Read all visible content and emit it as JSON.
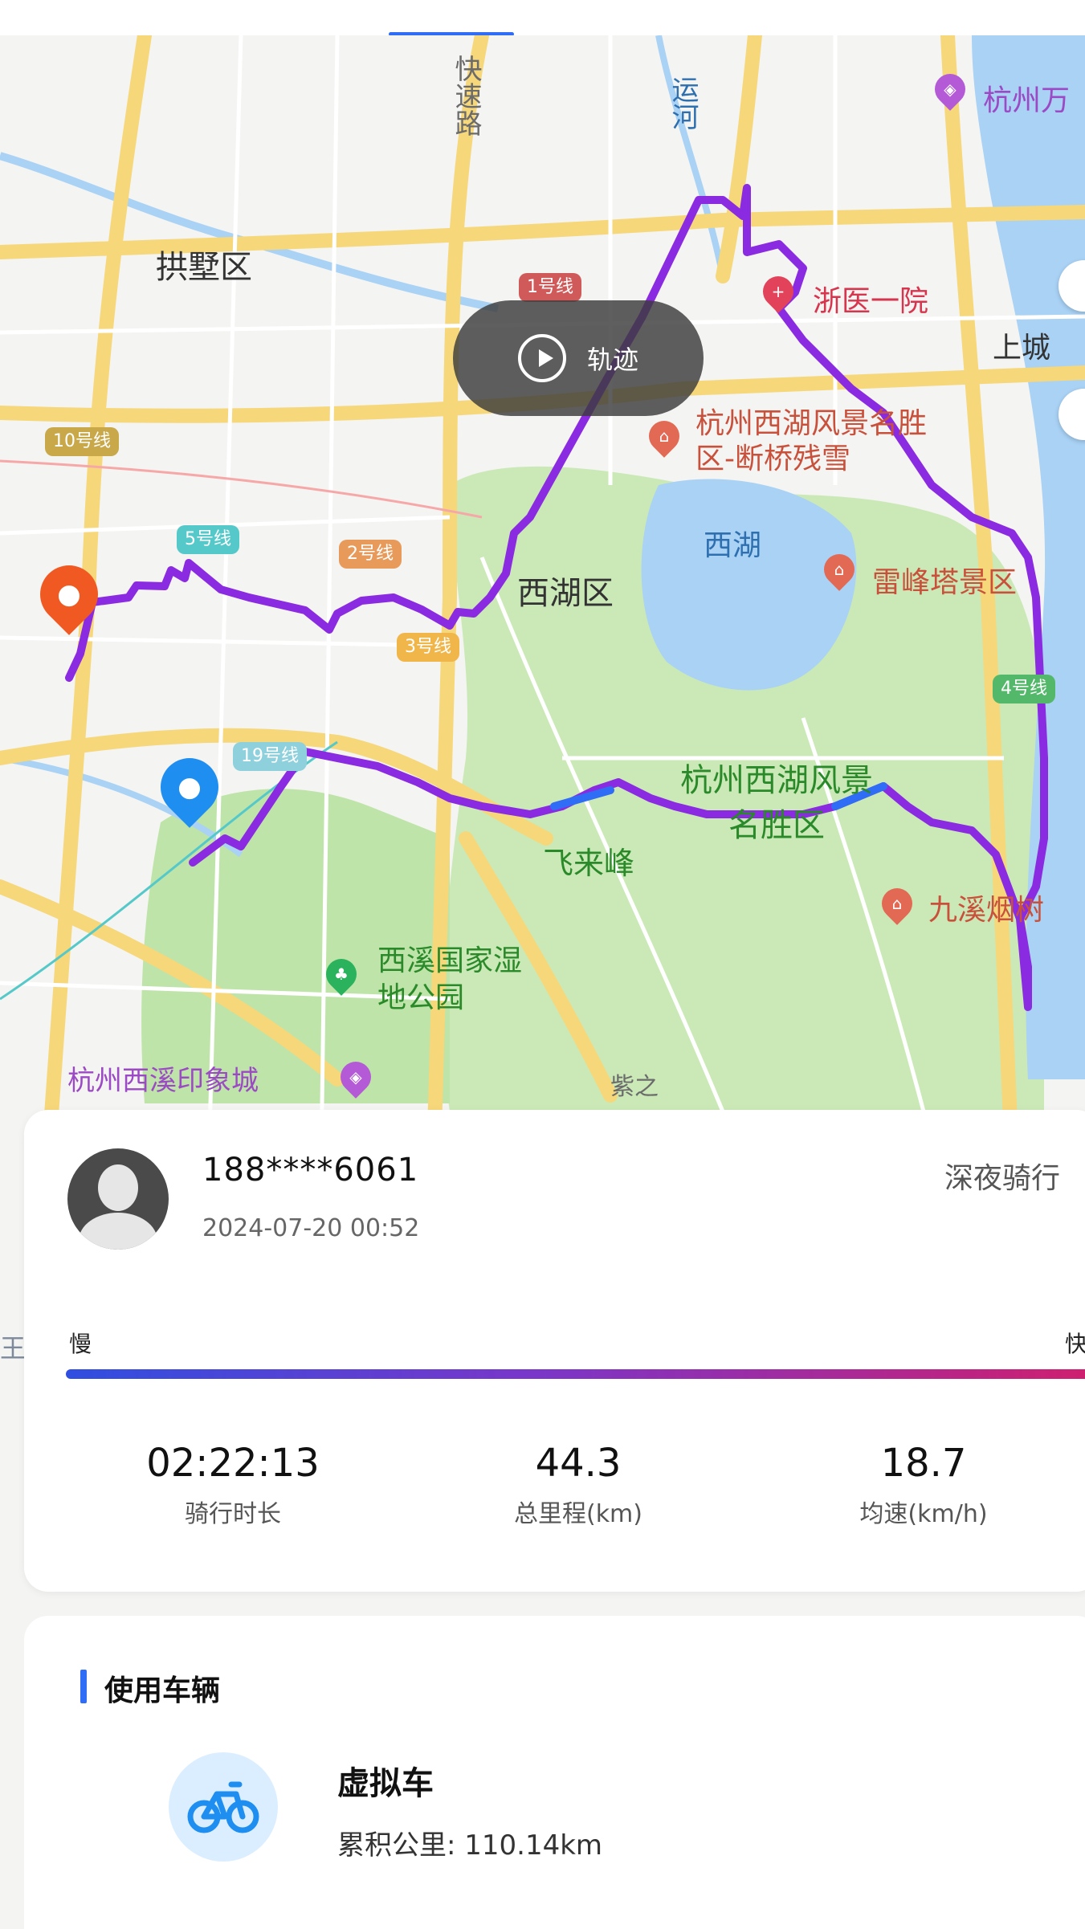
{
  "map": {
    "labels": {
      "gongshu": "拱墅区",
      "xihu_district": "西湖区",
      "xihu_lake": "西湖",
      "shangcheng": "上城",
      "feilaifeng": "飞来峰",
      "kuaisu_road": "快速路",
      "yunhe": "运河",
      "hangzhou_wan": "杭州万",
      "zheyi": "浙医一院",
      "duanqiao": "杭州西湖风景名胜区-断桥残雪",
      "leifeng": "雷峰塔景区",
      "scenic": "杭州西湖风景名胜区",
      "jiuxi": "九溪烟树",
      "xixi": "西溪国家湿地公园",
      "yinxiang": "杭州西溪印象城",
      "zi": "紫之",
      "metro_10": "10号线",
      "metro_5": "5号线",
      "metro_2": "2号线",
      "metro_3": "3号线",
      "metro_19": "19号线",
      "metro_4": "4号线",
      "metro_1": "1号线"
    },
    "trajectory_button": "轨迹"
  },
  "ride": {
    "phone": "188****6061",
    "datetime": "2024-07-20 00:52",
    "tag": "深夜骑行",
    "speed_slow": "慢",
    "speed_fast": "快",
    "stats": [
      {
        "value": "02:22:13",
        "label": "骑行时长"
      },
      {
        "value": "44.3",
        "label": "总里程(km)"
      },
      {
        "value": "18.7",
        "label": "均速(km/h)"
      }
    ]
  },
  "vehicle": {
    "section_title": "使用车辆",
    "name": "虚拟车",
    "total_km": "累积公里: 110.14km"
  },
  "colors": {
    "route": "#8a2be2",
    "accent_blue": "#2f6df6",
    "start_pin": "#1f8ef1",
    "end_pin": "#f05a22"
  }
}
